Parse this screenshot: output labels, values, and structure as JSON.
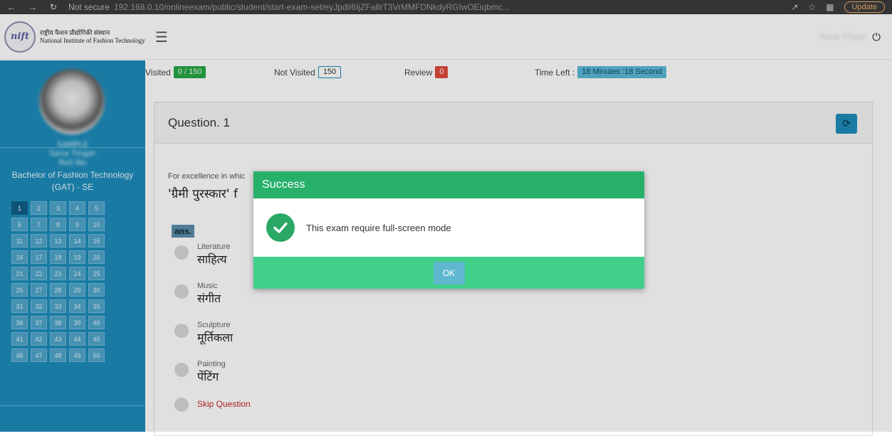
{
  "browser": {
    "security": "Not secure",
    "url": "192.168.0.10/onlineexam/public/student/start-exam-set/eyJpdiI6IjZFaIlrT3VrMMFDNkdyRGIwOEiqbmc...",
    "update_label": "Update"
  },
  "header": {
    "logo_mark": "nift",
    "logo_hindi": "राष्ट्रीय फैशन प्रौद्योगिकी संस्थान",
    "logo_english": "National Institute of Fashion Technology",
    "user_name": "Sana Tinger"
  },
  "sidebar": {
    "name_line_1": "SAMPLE",
    "name_line_2": "Sana Tinger",
    "name_line_3": "Roll No",
    "program_line_1": "Bachelor of Fashion Technology",
    "program_line_2": "(GAT) - SE",
    "questions": [
      "1",
      "2",
      "3",
      "4",
      "5",
      "6",
      "7",
      "8",
      "9",
      "10",
      "11",
      "12",
      "13",
      "14",
      "15",
      "16",
      "17",
      "18",
      "19",
      "20",
      "21",
      "22",
      "23",
      "24",
      "25",
      "26",
      "27",
      "28",
      "29",
      "30",
      "31",
      "32",
      "33",
      "34",
      "35",
      "36",
      "37",
      "38",
      "39",
      "40",
      "41",
      "42",
      "43",
      "44",
      "45",
      "46",
      "47",
      "48",
      "49",
      "50"
    ],
    "active_question": "1"
  },
  "status": {
    "visited_label": "Visited",
    "visited_value": "0 / 150",
    "not_visited_label": "Not Visited",
    "not_visited_value": "150",
    "review_label": "Review",
    "review_value": "0",
    "time_left_label": "Time Left :",
    "time_left_value": "18 Minutes :18 Second"
  },
  "question": {
    "title": "Question. 1",
    "text_en": "For excellence in whic",
    "text_hi": "'ग्रैमी पुरस्कार' f",
    "ans_label": "ans.",
    "options": [
      {
        "en": "Literature",
        "hi": "साहित्य"
      },
      {
        "en": "Music",
        "hi": "संगीत"
      },
      {
        "en": "Sculpture",
        "hi": "मूर्तिकला"
      },
      {
        "en": "Painting",
        "hi": "पेंटिंग"
      }
    ],
    "skip_label": "Skip Question"
  },
  "modal": {
    "title": "Success",
    "message": "This exam require full-screen mode",
    "ok_label": "OK"
  },
  "colors": {
    "sidebar": "#1d8dbb",
    "success_header": "#27b06a",
    "success_footer": "#41d08a"
  }
}
